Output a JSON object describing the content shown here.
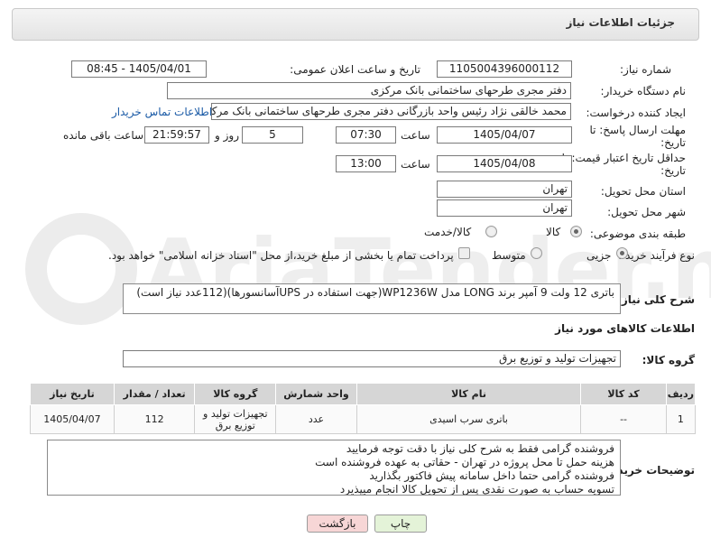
{
  "header": {
    "title": "جزئیات اطلاعات نیاز"
  },
  "fields": {
    "need_number_label": "شماره نیاز:",
    "need_number": "1105004396000112",
    "announce_label": "تاریخ و ساعت اعلان عمومی:",
    "announce_value": "1405/04/01 - 08:45",
    "buyer_org_label": "نام دستگاه خریدار:",
    "buyer_org": "دفتر مجری طرحهای ساختمانی بانک مرکزی",
    "creator_label": "ایجاد کننده درخواست:",
    "creator": "محمد خالقی نژاد رئیس واحد بازرگانی دفتر مجری طرحهای ساختمانی بانک مرکز",
    "contact_link": "اطلاعات تماس خریدار",
    "deadline_label": "مهلت ارسال پاسخ: تا تاریخ:",
    "deadline_date": "1405/04/07",
    "time_label": "ساعت",
    "deadline_time": "07:30",
    "days_value": "5",
    "days_label": "روز و",
    "remaining_time": "21:59:57",
    "remaining_label": "ساعت باقی مانده",
    "validity_label": "حداقل تاریخ اعتبار قیمت: تا تاریخ:",
    "validity_date": "1405/04/08",
    "validity_time_label": "ساعت",
    "validity_time": "13:00",
    "province_label": "استان محل تحویل:",
    "province": "تهران",
    "city_label": "شهر محل تحویل:",
    "city": "تهران",
    "category_label": "طبقه بندی موضوعی:",
    "cat_goods": "کالا",
    "cat_service": "کالا/خدمت",
    "process_label": "نوع فرآیند خرید :",
    "proc_partial": "جزیی",
    "proc_medium": "متوسط",
    "payment_text": "پرداخت تمام یا بخشی از مبلغ خرید،از محل \"اسناد خزانه اسلامی\" خواهد بود."
  },
  "summary": {
    "label": "شرح کلی نیاز:",
    "text": "باتری 12 ولت 9 آمپر برند LONG  مدل WP1236W(جهت استفاده در  UPSآسانسورها)(112عدد نیاز است)"
  },
  "goods_info": {
    "title": "اطلاعات کالاهای مورد نیاز",
    "group_label": "گروه کالا:",
    "group_value": "تجهیزات تولید و توزیع برق"
  },
  "table": {
    "headers": [
      "ردیف",
      "کد کالا",
      "نام کالا",
      "واحد شمارش",
      "گروه کالا",
      "تعداد / مقدار",
      "تاریخ نیاز"
    ],
    "rows": [
      [
        "1",
        "--",
        "باتری سرب اسیدی",
        "عدد",
        "تجهیزات تولید و توزیع برق",
        "112",
        "1405/04/07"
      ]
    ]
  },
  "notes": {
    "label": "توضیحات خریدار:",
    "lines": [
      "فروشنده گرامی فقط به شرح کلی نیاز  با دقت توجه فرمایید",
      "هزینه حمل تا محل پروژه در تهران - حقاتی به عهده فروشنده است",
      "فروشنده گرامی حتما داخل سامانه پیش فاکتور بگذارید",
      "تسویه حساب به صورت نقدی پس از تحویل کالا  انجام میپذیرد"
    ]
  },
  "buttons": {
    "print": "چاپ",
    "back": "بازگشت"
  },
  "colors": {
    "back_btn_bg": "#f7d6d6",
    "print_btn_bg": "#e4f3d8",
    "link": "#1a5aa6"
  }
}
